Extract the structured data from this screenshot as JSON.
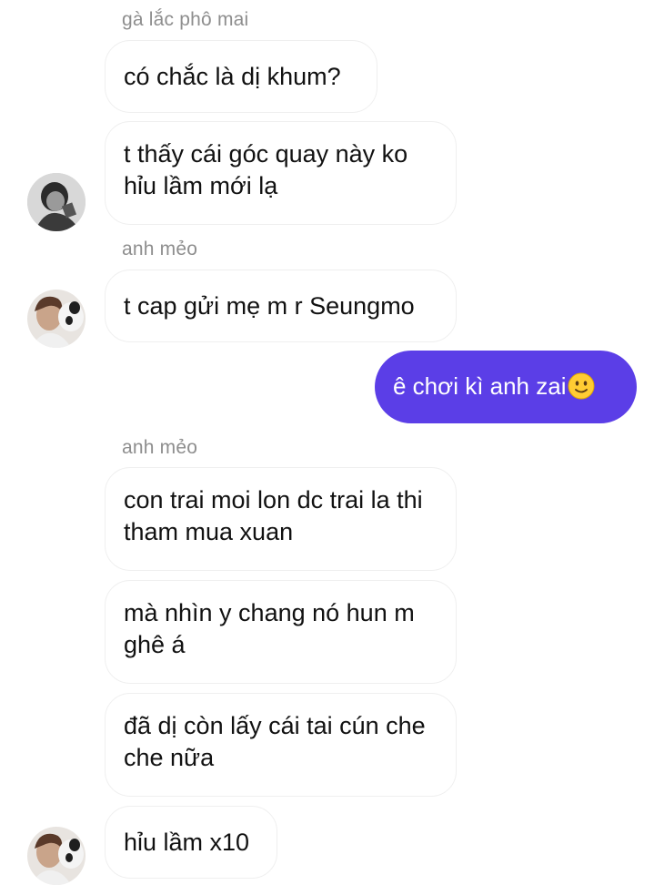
{
  "messages": {
    "sender1": "gà lắc phô mai",
    "m1": "có chắc là dị khum?",
    "m2": "t thấy cái góc quay này ko hỉu lầm mới lạ",
    "sender2": "anh mẻo",
    "m3": "t cap gửi mẹ m r Seungmo",
    "mine": "ê chơi kì anh zai",
    "sender3": "anh mẻo",
    "m4": "con trai moi lon dc trai la thi tham mua xuan",
    "m5": "mà nhìn y chang nó hun m ghê á",
    "m6": "đã dị còn lấy cái tai cún che che nữa",
    "m7": "hỉu lầm x10"
  },
  "colors": {
    "own_bubble": "#5b3ee7",
    "bubble_border": "#efefef",
    "sender_name": "#8e8e8e"
  },
  "icons": {
    "mine_emoji": "slightly-smiling-face-emoji"
  }
}
